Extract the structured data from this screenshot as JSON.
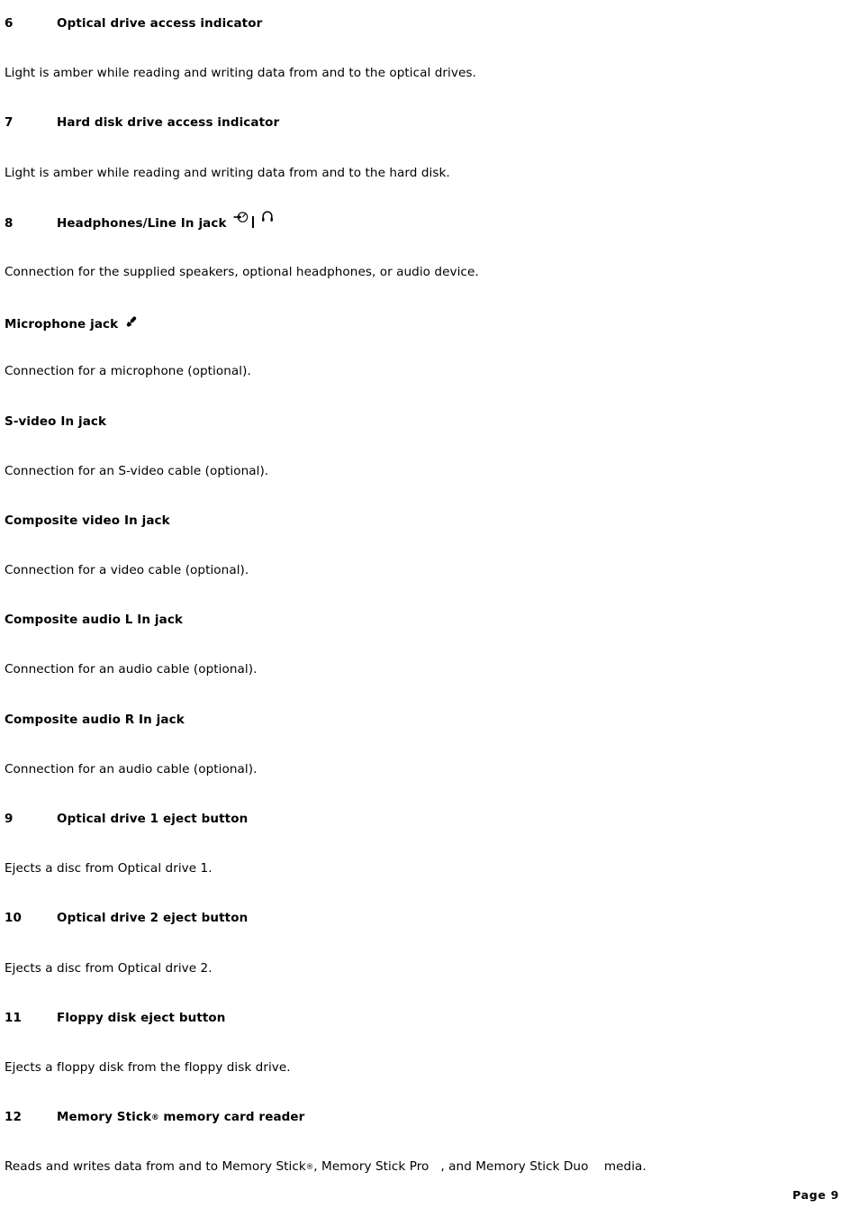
{
  "document": {
    "page_label": "Page 9",
    "blocks": [
      {
        "kind": "numbered-heading",
        "number": "6",
        "title": "Optical drive access indicator",
        "icons": []
      },
      {
        "kind": "body",
        "text": "Light is amber while reading and writing data from and to the optical drives."
      },
      {
        "kind": "numbered-heading",
        "number": "7",
        "title": "Hard disk drive access indicator",
        "icons": []
      },
      {
        "kind": "body",
        "text": "Light is amber while reading and writing data from and to the hard disk."
      },
      {
        "kind": "numbered-heading",
        "number": "8",
        "title": "Headphones/Line In jack",
        "icons": [
          "line-in-icon",
          "separator",
          "headphones-icon"
        ]
      },
      {
        "kind": "body",
        "text": "Connection for the supplied speakers, optional headphones, or audio device."
      },
      {
        "kind": "sub-heading",
        "title": "Microphone jack",
        "icons": [
          "microphone-icon"
        ]
      },
      {
        "kind": "body",
        "text": "Connection for a microphone (optional)."
      },
      {
        "kind": "sub-heading",
        "title": "S-video In jack",
        "icons": []
      },
      {
        "kind": "body",
        "text": "Connection for an S-video cable (optional)."
      },
      {
        "kind": "sub-heading",
        "title": "Composite video In jack",
        "icons": []
      },
      {
        "kind": "body",
        "text": "Connection for a video cable (optional)."
      },
      {
        "kind": "sub-heading",
        "title": "Composite audio L In jack",
        "icons": []
      },
      {
        "kind": "body",
        "text": "Connection for an audio cable (optional)."
      },
      {
        "kind": "sub-heading",
        "title": "Composite audio R In jack",
        "icons": []
      },
      {
        "kind": "body",
        "text": "Connection for an audio cable (optional)."
      },
      {
        "kind": "numbered-heading",
        "number": "9",
        "title": "Optical drive 1 eject button",
        "icons": []
      },
      {
        "kind": "body",
        "text": "Ejects a disc from Optical drive 1."
      },
      {
        "kind": "numbered-heading",
        "number": "10",
        "title": "Optical drive 2 eject button",
        "icons": []
      },
      {
        "kind": "body",
        "text": "Ejects a disc from Optical drive 2."
      },
      {
        "kind": "numbered-heading",
        "number": "11",
        "title": "Floppy disk eject button",
        "icons": []
      },
      {
        "kind": "body",
        "text": "Ejects a floppy disk from the floppy disk drive."
      },
      {
        "kind": "numbered-heading-rich",
        "number": "12",
        "title_parts": [
          {
            "type": "text",
            "value": "Memory Stick"
          },
          {
            "type": "reg",
            "value": "®"
          },
          {
            "type": "text",
            "value": " memory card reader"
          }
        ],
        "icons": []
      },
      {
        "kind": "body-rich",
        "text_parts": [
          {
            "type": "text",
            "value": "Reads and writes data from and to Memory Stick"
          },
          {
            "type": "reg",
            "value": "®"
          },
          {
            "type": "text",
            "value": ", Memory Stick Pro"
          },
          {
            "type": "gap",
            "value": ""
          },
          {
            "type": "text",
            "value": ", and Memory Stick Duo"
          },
          {
            "type": "gap",
            "value": ""
          },
          {
            "type": "text",
            "value": " media."
          }
        ]
      }
    ]
  },
  "colors": {
    "background": "#ffffff",
    "text": "#000000"
  }
}
